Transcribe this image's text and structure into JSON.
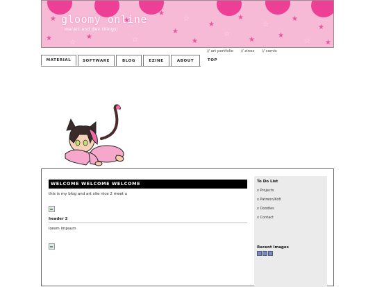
{
  "banner": {
    "title": "gloomy online",
    "subtitle": "ma'art and dev things!"
  },
  "toplinks": [
    "// art portfolio",
    "// zinez",
    "// comic"
  ],
  "nav": {
    "tabs": [
      "MATERIAL",
      "SOFTWARE",
      "BLOG",
      "EZINE",
      "ABOUT",
      "TOP"
    ],
    "active": "MATERIAL"
  },
  "main": {
    "welcome": "WELCOME WELCOME WELCOME",
    "intro": "this is my blog and art site nice 2 meet u",
    "header2": "header 2",
    "body": "lorem impsum"
  },
  "sidebar": {
    "todo_title": "To Do List",
    "todo_items": [
      "x Projects",
      "x Patreon/Kofi",
      "x Doodles",
      "x Contact"
    ],
    "recent_title": "Recent Images"
  },
  "colors": {
    "banner_bg": "#f6b9d6",
    "banner_accent": "#ee3f97",
    "sidebar_bg": "#ebebeb"
  }
}
